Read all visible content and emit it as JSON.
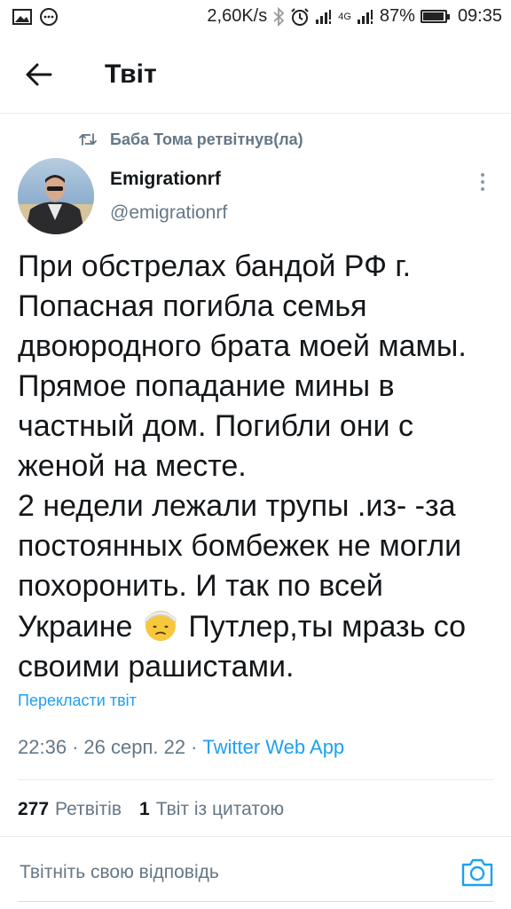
{
  "status_bar": {
    "speed": "2,60K/s",
    "network": "4G",
    "battery": "87%",
    "battery_level": 0.87,
    "time": "09:35"
  },
  "header": {
    "title": "Твіт"
  },
  "retweet_context": {
    "text": "Баба Тома ретвітнув(ла)"
  },
  "author": {
    "name": "Emigrationrf",
    "handle": "@emigrationrf"
  },
  "tweet": {
    "text_part1": "При обстрелах бандой РФ г. Попасная погибла семья двоюродного брата моей мамы. Прямое попадание мины в частный дом. Погибли они с женой на месте.\n2 недели лежали трупы .из- -за постоянных бомбежек не могли похоронить. И так по всей Украине",
    "emoji": "face-with-head-bandage",
    "text_part2": " Путлер,ты мразь со своими рашистами.",
    "translate": "Перекласти твіт"
  },
  "meta": {
    "time": "22:36",
    "sep1": "·",
    "date": "26 серп. 22",
    "sep2": "·",
    "source": "Twitter Web App"
  },
  "stats": {
    "retweets_count": "277",
    "retweets_label": "Ретвітів",
    "quotes_count": "1",
    "quotes_label": "Твіт із цитатою"
  },
  "reply": {
    "placeholder": "Твітніть свою відповідь"
  },
  "colors": {
    "accent": "#1da1f2",
    "secondary_text": "#657786",
    "primary_text": "#14171a"
  }
}
